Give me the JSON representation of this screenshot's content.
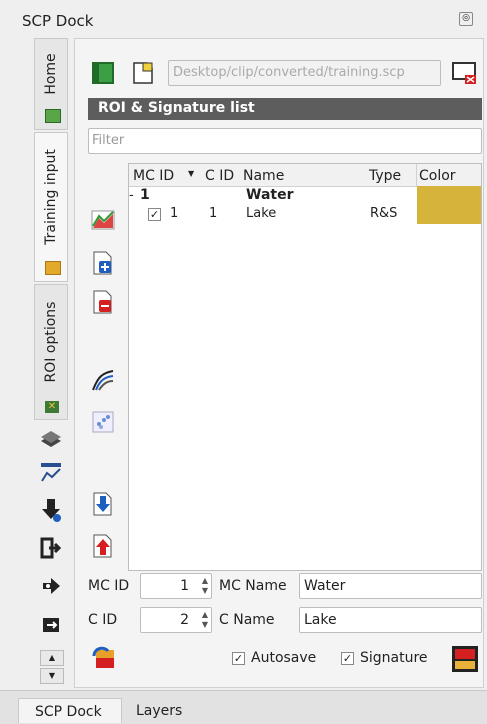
{
  "dock": {
    "title": "SCP Dock"
  },
  "side_tabs": {
    "home": "Home",
    "training_input": "Training input",
    "roi_options": "ROI options"
  },
  "top": {
    "path_placeholder": "Desktop/clip/converted/training.scp"
  },
  "roi_section": {
    "title": "ROI & Signature list",
    "filter_placeholder": "Filter"
  },
  "table": {
    "headers": {
      "mc_id": "MC ID",
      "c_id": "C ID",
      "name": "Name",
      "type": "Type",
      "color": "Color"
    },
    "group": {
      "expander": "-",
      "mc_id": "1",
      "name": "Water"
    },
    "rows": [
      {
        "mc_id": "1",
        "c_id": "1",
        "name": "Lake",
        "type": "R&S",
        "checked": "✓"
      }
    ]
  },
  "bottom": {
    "mc_id_label": "MC ID",
    "mc_id_value": "1",
    "mc_name_label": "MC Name",
    "mc_name_value": "Water",
    "c_id_label": "C ID",
    "c_id_value": "2",
    "c_name_label": "C Name",
    "c_name_value": "Lake",
    "autosave_label": "Autosave",
    "signature_label": "Signature",
    "check_mark": "✓"
  },
  "bottom_tabs": {
    "scp_dock": "SCP Dock",
    "layers": "Layers"
  },
  "colors": {
    "class_color": "#d6b33a",
    "accent_blue": "#1f5fbf",
    "accent_red": "#d42020",
    "accent_green": "#2e9a35"
  },
  "icons": [
    "close-float-icon",
    "new-file-icon",
    "open-file-icon",
    "close-file-icon",
    "show-signature-icon",
    "add-roi-icon",
    "remove-roi-icon",
    "spectral-plot-icon",
    "scatter-plot-icon",
    "import-icon",
    "export-icon",
    "layers-icon",
    "plot-icon",
    "download-icon",
    "enter-icon",
    "arrow-right-icon",
    "export-sidebar-icon",
    "scroll-up-icon",
    "scroll-down-icon",
    "reset-icon",
    "save-icon"
  ]
}
